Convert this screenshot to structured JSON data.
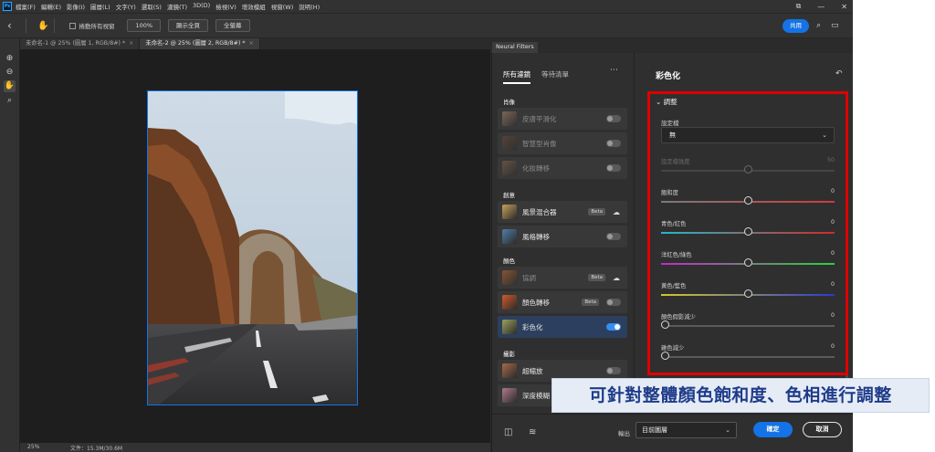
{
  "app": {
    "logo": "Ps",
    "menu": [
      "檔案(F)",
      "編輯(E)",
      "影像(I)",
      "圖層(L)",
      "文字(Y)",
      "選取(S)",
      "濾鏡(T)",
      "3D(D)",
      "檢視(V)",
      "增效模組",
      "視窗(W)",
      "說明(H)"
    ],
    "window_controls": [
      "restore-icon",
      "minimize-icon",
      "close-icon"
    ]
  },
  "options_bar": {
    "scroll_all_label": "捲動所有視窗",
    "zoom_value": "100%",
    "fit_screen_label": "顯示全頁",
    "fill_screen_label": "全螢幕",
    "share_label": "共用"
  },
  "tabs": [
    {
      "label": "未命名-1 @ 25% (圖層 1, RGB/8#) *",
      "active": false
    },
    {
      "label": "未命名-2 @ 25% (圖層 2, RGB/8#) *",
      "active": true
    }
  ],
  "status": {
    "zoom": "25%",
    "doc": "文件：15.3M/30.6M"
  },
  "neural_filters": {
    "panel_tab": "Neural Filters",
    "tabs": [
      "所有濾鏡",
      "等待清單"
    ],
    "sections": [
      {
        "title": "肖像",
        "items": [
          {
            "name": "皮膚平滑化",
            "badge": "",
            "control": "toggle",
            "on": false,
            "disabled": true,
            "thumb": "#b58a72"
          },
          {
            "name": "智慧型肖像",
            "badge": "",
            "control": "toggle",
            "on": false,
            "disabled": true,
            "thumb": "#6b4a3a"
          },
          {
            "name": "化妝轉移",
            "badge": "",
            "control": "toggle",
            "on": false,
            "disabled": true,
            "thumb": "#8a6550"
          }
        ]
      },
      {
        "title": "創意",
        "items": [
          {
            "name": "風景混合器",
            "badge": "Beta",
            "control": "cloud",
            "on": false,
            "disabled": false,
            "thumb": "#c9a25a"
          },
          {
            "name": "風格轉移",
            "badge": "",
            "control": "toggle",
            "on": false,
            "disabled": false,
            "thumb": "#4f7fa8"
          }
        ]
      },
      {
        "title": "顏色",
        "items": [
          {
            "name": "協調",
            "badge": "Beta",
            "control": "cloud",
            "on": false,
            "disabled": true,
            "thumb": "#c86a2a"
          },
          {
            "name": "顏色轉移",
            "badge": "Beta",
            "control": "toggle",
            "on": false,
            "disabled": false,
            "thumb": "#d25a2a"
          },
          {
            "name": "彩色化",
            "badge": "",
            "control": "toggle",
            "on": true,
            "disabled": false,
            "thumb": "#9aa35a"
          }
        ]
      },
      {
        "title": "攝影",
        "items": [
          {
            "name": "超縮放",
            "badge": "",
            "control": "toggle",
            "on": false,
            "disabled": false,
            "thumb": "#a86a4a"
          },
          {
            "name": "深度模糊",
            "badge": "",
            "control": "toggle",
            "on": false,
            "disabled": false,
            "thumb": "#b07a8a"
          }
        ]
      }
    ],
    "detail": {
      "title": "彩色化",
      "adjust_heading": "調整",
      "preset_label": "設定檔",
      "preset_value": "無",
      "sliders": [
        {
          "label": "設定檔強度",
          "value": "50",
          "fraction": 0.5,
          "disabled": true,
          "track": "#5a5a5a"
        },
        {
          "label": "飽和度",
          "value": "0",
          "fraction": 0.5,
          "disabled": false,
          "track": "linear-gradient(90deg,#7a7a7a,#d23a3a)"
        },
        {
          "label": "青色/紅色",
          "value": "0",
          "fraction": 0.5,
          "disabled": false,
          "track": "linear-gradient(90deg,#22b8c8,#d22a2a)"
        },
        {
          "label": "洋紅色/綠色",
          "value": "0",
          "fraction": 0.5,
          "disabled": false,
          "track": "linear-gradient(90deg,#c22ac8,#2ad23a)"
        },
        {
          "label": "黃色/藍色",
          "value": "0",
          "fraction": 0.5,
          "disabled": false,
          "track": "linear-gradient(90deg,#d2c82a,#2a3ad2)"
        },
        {
          "label": "顏色假影減少",
          "value": "0",
          "fraction": 0.0,
          "disabled": false,
          "track": "#5a5a5a"
        },
        {
          "label": "雜色減少",
          "value": "0",
          "fraction": 0.0,
          "disabled": false,
          "track": "#5a5a5a"
        }
      ]
    },
    "footer": {
      "output_label": "輸出",
      "output_value": "目前圖層",
      "ok_label": "確定",
      "cancel_label": "取消"
    }
  },
  "caption": "可針對整體顏色飽和度、色相進行調整"
}
